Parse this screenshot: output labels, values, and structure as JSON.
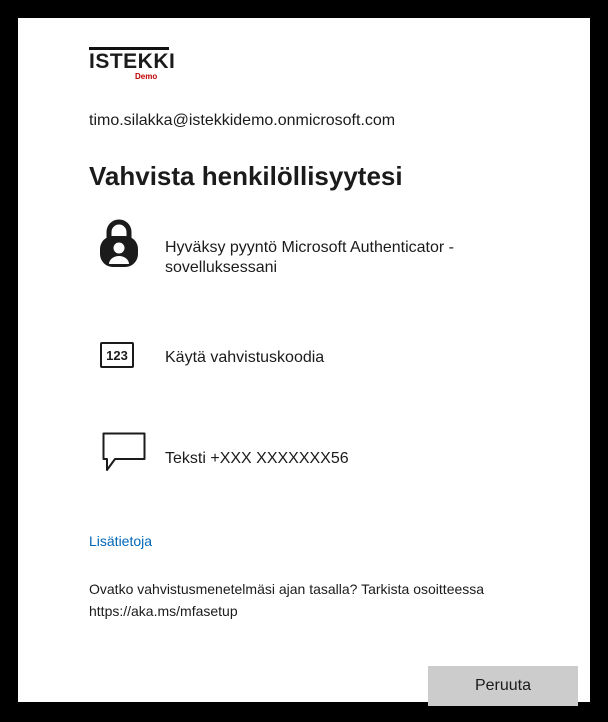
{
  "brand": {
    "logo_text": "ISTEKKI",
    "logo_sub": "Demo"
  },
  "account": {
    "email": "timo.silakka@istekkidemo.onmicrosoft.com"
  },
  "title": "Vahvista henkilöllisyytesi",
  "options": [
    {
      "icon": "authenticator-lock-icon",
      "label": "Hyväksy pyyntö Microsoft Authenticator -sovelluksessani"
    },
    {
      "icon": "verification-code-icon",
      "icon_text": "123",
      "label": "Käytä vahvistuskoodia"
    },
    {
      "icon": "message-bubble-icon",
      "label": "Teksti +XXX XXXXXXX56"
    }
  ],
  "more_info_link": "Lisätietoja",
  "footer_text": "Ovatko vahvistusmenetelmäsi ajan tasalla? Tarkista osoitteessa https://aka.ms/mfasetup",
  "cancel_button": "Peruuta",
  "colors": {
    "link": "#0067b8",
    "button_bg": "#cccccc",
    "text": "#1b1b1b",
    "logo_demo": "#c00000"
  }
}
